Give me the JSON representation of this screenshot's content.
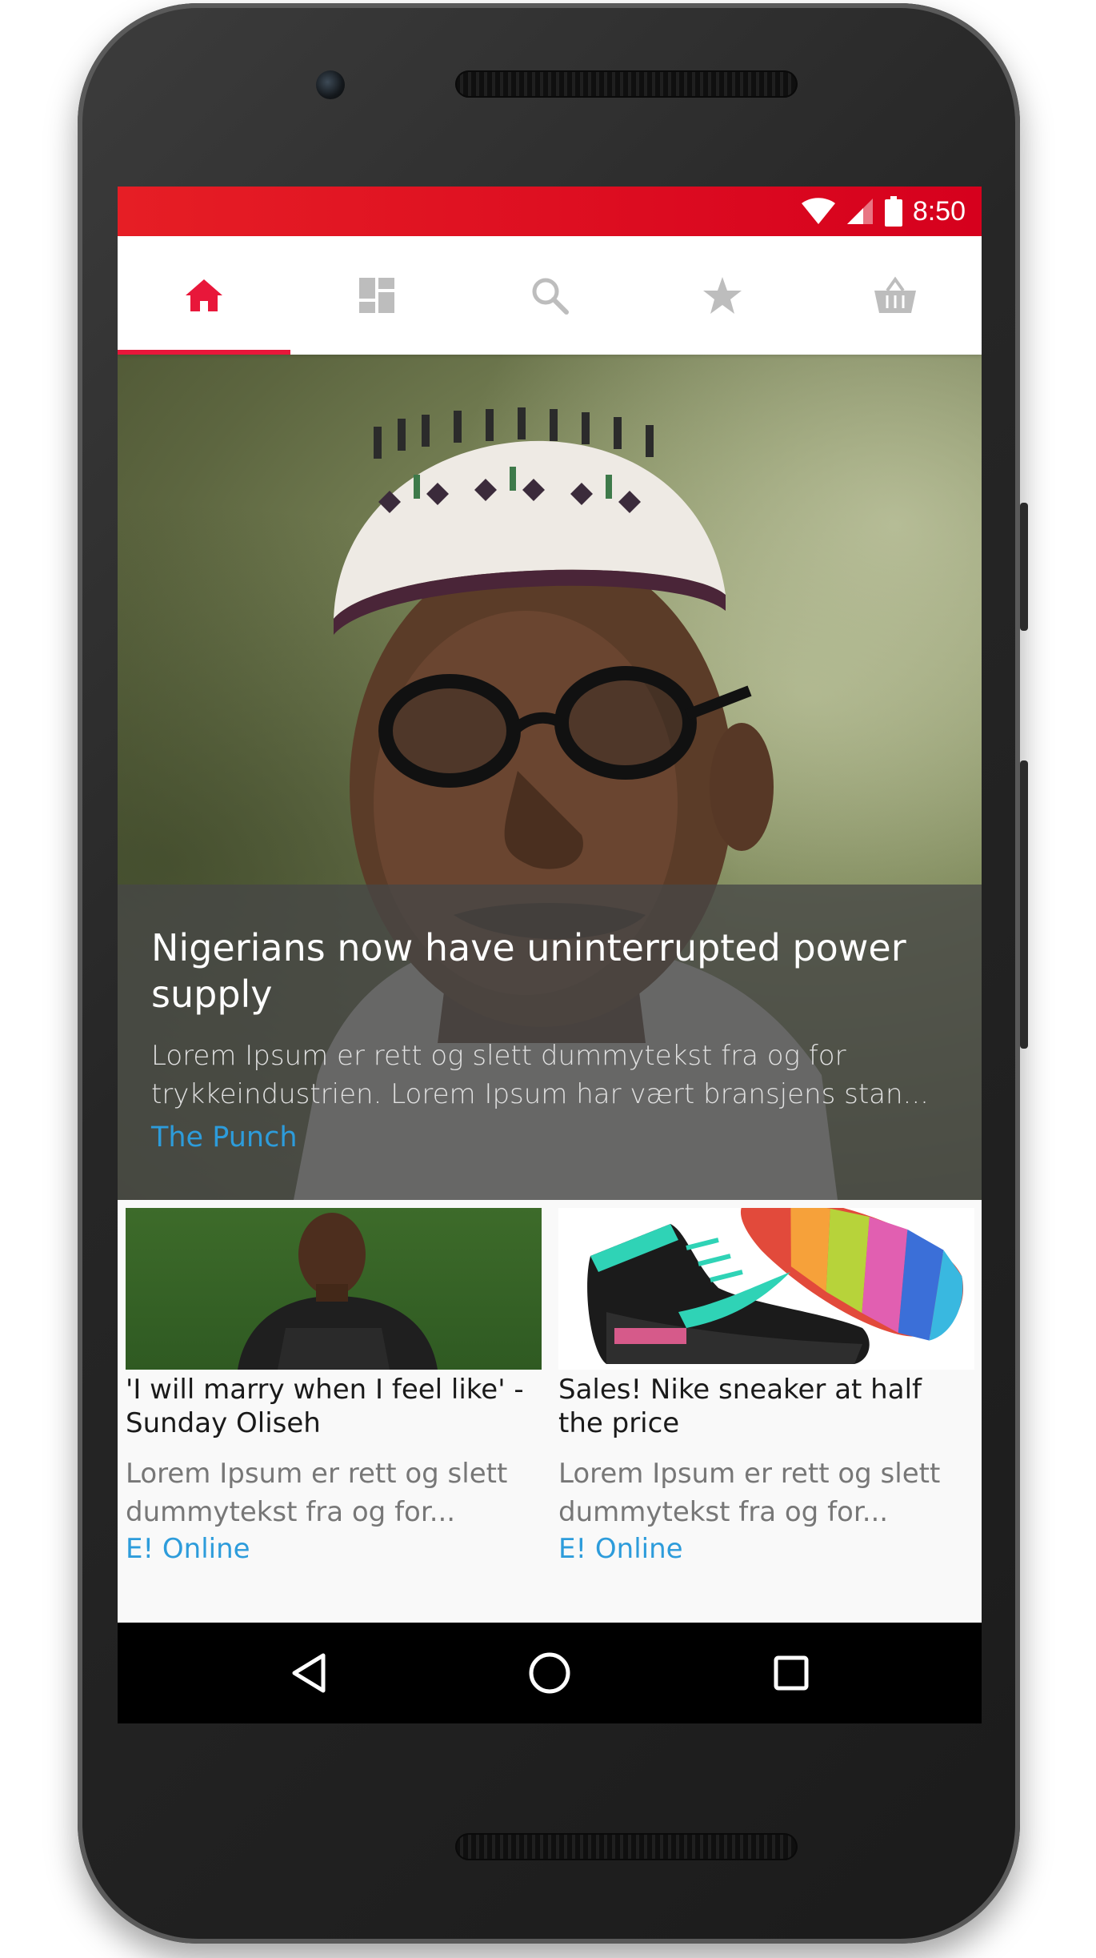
{
  "status_bar": {
    "time": "8:50",
    "icons": [
      "wifi-icon",
      "cellular-signal-icon",
      "battery-icon"
    ],
    "background_color": "#e21b22"
  },
  "tabs": [
    {
      "name": "home",
      "icon": "home-icon",
      "active": true
    },
    {
      "name": "dashboard",
      "icon": "dashboard-icon",
      "active": false
    },
    {
      "name": "search",
      "icon": "search-icon",
      "active": false
    },
    {
      "name": "favorites",
      "icon": "star-icon",
      "active": false
    },
    {
      "name": "shop",
      "icon": "basket-icon",
      "active": false
    }
  ],
  "accent_color": "#e8173a",
  "link_color": "#2d9cdb",
  "hero": {
    "title": "Nigerians now have uninterrupted power supply",
    "description": "Lorem Ipsum er rett og slett dummytekst fra og for trykkeindustrien. Lorem Ipsum har vært bransjens stan...",
    "source": "The Punch"
  },
  "cards": [
    {
      "title": "'I will marry when I feel like' - Sunday Oliseh",
      "description": "Lorem Ipsum er rett og slett dummytekst fra og for...",
      "source": "E! Online"
    },
    {
      "title": "Sales! Nike sneaker at half the price",
      "description": "Lorem Ipsum er rett og slett dummytekst fra og for...",
      "source": "E! Online"
    }
  ],
  "nav_bar": {
    "buttons": [
      "back-icon",
      "home-circle-icon",
      "recents-icon"
    ]
  }
}
